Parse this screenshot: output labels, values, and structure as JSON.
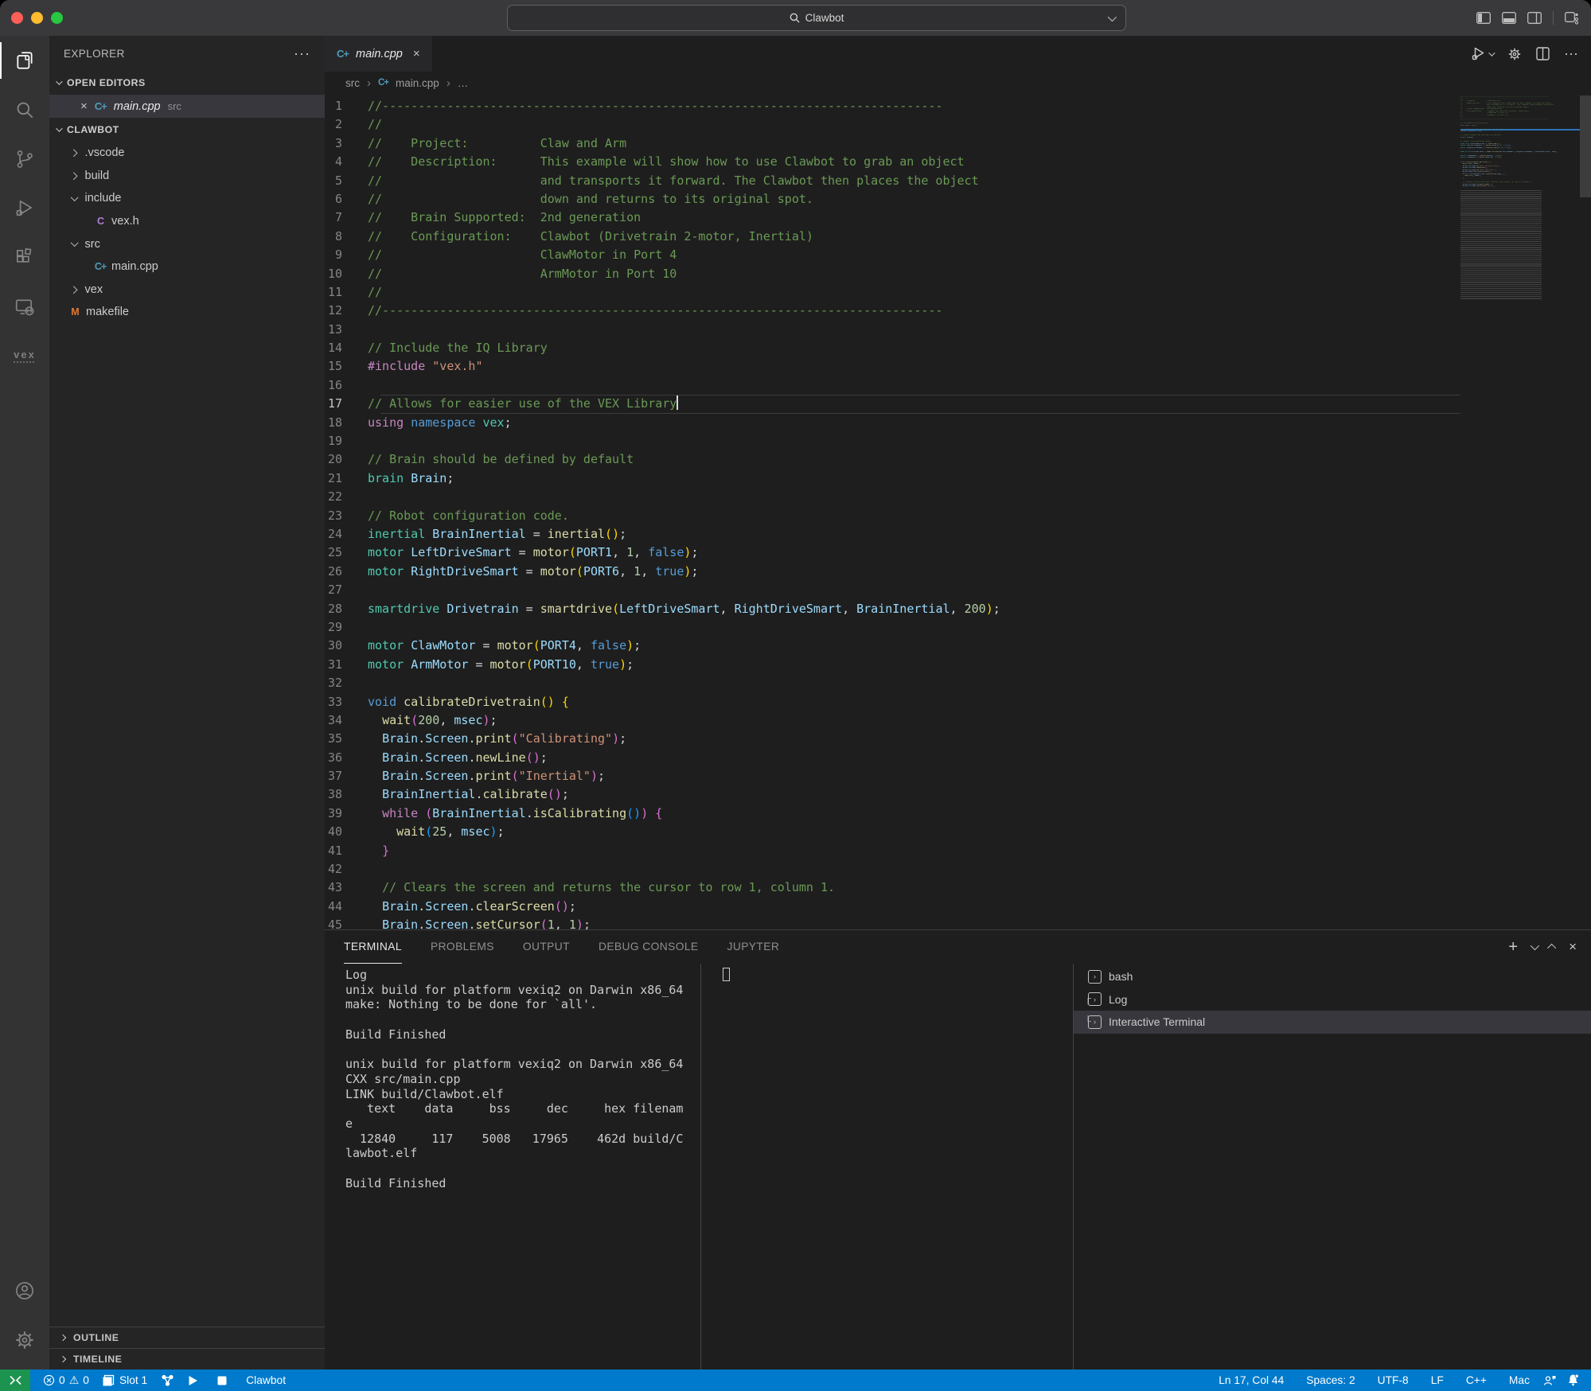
{
  "titlebar": {
    "search_value": "Clawbot"
  },
  "activity_bar": {
    "items": [
      "explorer",
      "search",
      "source-control",
      "run-debug",
      "extensions",
      "remote-explorer",
      "vex"
    ],
    "vex_label": "vex",
    "bottom": [
      "account",
      "settings"
    ]
  },
  "sidebar": {
    "title": "EXPLORER",
    "open_editors_label": "OPEN EDITORS",
    "open_editor": {
      "close": "×",
      "name": "main.cpp",
      "detail": "src"
    },
    "project_label": "CLAWBOT",
    "tree": [
      {
        "label": ".vscode",
        "kind": "folder",
        "state": "collapsed"
      },
      {
        "label": "build",
        "kind": "folder",
        "state": "collapsed"
      },
      {
        "label": "include",
        "kind": "folder",
        "state": "expanded"
      },
      {
        "label": "vex.h",
        "kind": "file",
        "icon": "C",
        "icon_color": "#b180d7",
        "child": true
      },
      {
        "label": "src",
        "kind": "folder",
        "state": "expanded"
      },
      {
        "label": "main.cpp",
        "kind": "file",
        "icon": "C+",
        "icon_color": "#519aba",
        "child": true
      },
      {
        "label": "vex",
        "kind": "folder",
        "state": "collapsed"
      },
      {
        "label": "makefile",
        "kind": "file",
        "icon": "M",
        "icon_color": "#e37933",
        "child": false
      }
    ],
    "bottom_sections": [
      {
        "label": "OUTLINE"
      },
      {
        "label": "TIMELINE"
      }
    ]
  },
  "editor": {
    "tab_title": "main.cpp",
    "breadcrumbs": [
      "src",
      "main.cpp",
      "…"
    ],
    "cursor": {
      "line": 17,
      "col": 44
    },
    "code": [
      [
        [
          "//------------------------------------------------------------------------------",
          "cm"
        ]
      ],
      [
        [
          "//",
          "cm"
        ]
      ],
      [
        [
          "//    Project:          Claw and Arm",
          "cm"
        ]
      ],
      [
        [
          "//    Description:      This example will show how to use Clawbot to grab an object",
          "cm"
        ]
      ],
      [
        [
          "//                      and transports it forward. The Clawbot then places the object",
          "cm"
        ]
      ],
      [
        [
          "//                      down and returns to its original spot.",
          "cm"
        ]
      ],
      [
        [
          "//    Brain Supported:  2nd generation",
          "cm"
        ]
      ],
      [
        [
          "//    Configuration:    Clawbot (Drivetrain 2-motor, Inertial)",
          "cm"
        ]
      ],
      [
        [
          "//                      ClawMotor in Port 4",
          "cm"
        ]
      ],
      [
        [
          "//                      ArmMotor in Port 10",
          "cm"
        ]
      ],
      [
        [
          "//",
          "cm"
        ]
      ],
      [
        [
          "//------------------------------------------------------------------------------",
          "cm"
        ]
      ],
      [],
      [
        [
          "// Include the IQ Library",
          "cm"
        ]
      ],
      [
        [
          "#include",
          "ctl"
        ],
        [
          " ",
          "pl"
        ],
        [
          "\"vex.h\"",
          "str"
        ]
      ],
      [],
      [
        [
          "// Allows for easier use of the VEX Library",
          "cm"
        ]
      ],
      [
        [
          "using",
          "ctl"
        ],
        [
          " ",
          "pl"
        ],
        [
          "namespace",
          "kw"
        ],
        [
          " ",
          "pl"
        ],
        [
          "vex",
          "ty"
        ],
        [
          ";",
          "pl"
        ]
      ],
      [],
      [
        [
          "// Brain should be defined by default",
          "cm"
        ]
      ],
      [
        [
          "brain",
          "ty"
        ],
        [
          " ",
          "pl"
        ],
        [
          "Brain",
          "var"
        ],
        [
          ";",
          "pl"
        ]
      ],
      [],
      [
        [
          "// Robot configuration code.",
          "cm"
        ]
      ],
      [
        [
          "inertial",
          "ty"
        ],
        [
          " ",
          "pl"
        ],
        [
          "BrainInertial",
          "var"
        ],
        [
          " = ",
          "pl"
        ],
        [
          "inertial",
          "fn"
        ],
        [
          "(",
          "p1"
        ],
        [
          ")",
          "p1"
        ],
        [
          ";",
          "pl"
        ]
      ],
      [
        [
          "motor",
          "ty"
        ],
        [
          " ",
          "pl"
        ],
        [
          "LeftDriveSmart",
          "var"
        ],
        [
          " = ",
          "pl"
        ],
        [
          "motor",
          "fn"
        ],
        [
          "(",
          "p1"
        ],
        [
          "PORT1",
          "var"
        ],
        [
          ", ",
          "pl"
        ],
        [
          "1",
          "num"
        ],
        [
          ", ",
          "pl"
        ],
        [
          "false",
          "kw"
        ],
        [
          ")",
          "p1"
        ],
        [
          ";",
          "pl"
        ]
      ],
      [
        [
          "motor",
          "ty"
        ],
        [
          " ",
          "pl"
        ],
        [
          "RightDriveSmart",
          "var"
        ],
        [
          " = ",
          "pl"
        ],
        [
          "motor",
          "fn"
        ],
        [
          "(",
          "p1"
        ],
        [
          "PORT6",
          "var"
        ],
        [
          ", ",
          "pl"
        ],
        [
          "1",
          "num"
        ],
        [
          ", ",
          "pl"
        ],
        [
          "true",
          "kw"
        ],
        [
          ")",
          "p1"
        ],
        [
          ";",
          "pl"
        ]
      ],
      [],
      [
        [
          "smartdrive",
          "ty"
        ],
        [
          " ",
          "pl"
        ],
        [
          "Drivetrain",
          "var"
        ],
        [
          " = ",
          "pl"
        ],
        [
          "smartdrive",
          "fn"
        ],
        [
          "(",
          "p1"
        ],
        [
          "LeftDriveSmart",
          "var"
        ],
        [
          ", ",
          "pl"
        ],
        [
          "RightDriveSmart",
          "var"
        ],
        [
          ", ",
          "pl"
        ],
        [
          "BrainInertial",
          "var"
        ],
        [
          ", ",
          "pl"
        ],
        [
          "200",
          "num"
        ],
        [
          ")",
          "p1"
        ],
        [
          ";",
          "pl"
        ]
      ],
      [],
      [
        [
          "motor",
          "ty"
        ],
        [
          " ",
          "pl"
        ],
        [
          "ClawMotor",
          "var"
        ],
        [
          " = ",
          "pl"
        ],
        [
          "motor",
          "fn"
        ],
        [
          "(",
          "p1"
        ],
        [
          "PORT4",
          "var"
        ],
        [
          ", ",
          "pl"
        ],
        [
          "false",
          "kw"
        ],
        [
          ")",
          "p1"
        ],
        [
          ";",
          "pl"
        ]
      ],
      [
        [
          "motor",
          "ty"
        ],
        [
          " ",
          "pl"
        ],
        [
          "ArmMotor",
          "var"
        ],
        [
          " = ",
          "pl"
        ],
        [
          "motor",
          "fn"
        ],
        [
          "(",
          "p1"
        ],
        [
          "PORT10",
          "var"
        ],
        [
          ", ",
          "pl"
        ],
        [
          "true",
          "kw"
        ],
        [
          ")",
          "p1"
        ],
        [
          ";",
          "pl"
        ]
      ],
      [],
      [
        [
          "void",
          "kw"
        ],
        [
          " ",
          "pl"
        ],
        [
          "calibrateDrivetrain",
          "fn"
        ],
        [
          "(",
          "p1"
        ],
        [
          ")",
          "p1"
        ],
        [
          " ",
          "pl"
        ],
        [
          "{",
          "p1"
        ]
      ],
      [
        [
          "  ",
          "pl"
        ],
        [
          "wait",
          "fn"
        ],
        [
          "(",
          "p2"
        ],
        [
          "200",
          "num"
        ],
        [
          ", ",
          "pl"
        ],
        [
          "msec",
          "var"
        ],
        [
          ")",
          "p2"
        ],
        [
          ";",
          "pl"
        ]
      ],
      [
        [
          "  ",
          "pl"
        ],
        [
          "Brain",
          "var"
        ],
        [
          ".",
          "pl"
        ],
        [
          "Screen",
          "var"
        ],
        [
          ".",
          "pl"
        ],
        [
          "print",
          "fn"
        ],
        [
          "(",
          "p2"
        ],
        [
          "\"Calibrating\"",
          "str"
        ],
        [
          ")",
          "p2"
        ],
        [
          ";",
          "pl"
        ]
      ],
      [
        [
          "  ",
          "pl"
        ],
        [
          "Brain",
          "var"
        ],
        [
          ".",
          "pl"
        ],
        [
          "Screen",
          "var"
        ],
        [
          ".",
          "pl"
        ],
        [
          "newLine",
          "fn"
        ],
        [
          "(",
          "p2"
        ],
        [
          ")",
          "p2"
        ],
        [
          ";",
          "pl"
        ]
      ],
      [
        [
          "  ",
          "pl"
        ],
        [
          "Brain",
          "var"
        ],
        [
          ".",
          "pl"
        ],
        [
          "Screen",
          "var"
        ],
        [
          ".",
          "pl"
        ],
        [
          "print",
          "fn"
        ],
        [
          "(",
          "p2"
        ],
        [
          "\"Inertial\"",
          "str"
        ],
        [
          ")",
          "p2"
        ],
        [
          ";",
          "pl"
        ]
      ],
      [
        [
          "  ",
          "pl"
        ],
        [
          "BrainInertial",
          "var"
        ],
        [
          ".",
          "pl"
        ],
        [
          "calibrate",
          "fn"
        ],
        [
          "(",
          "p2"
        ],
        [
          ")",
          "p2"
        ],
        [
          ";",
          "pl"
        ]
      ],
      [
        [
          "  ",
          "pl"
        ],
        [
          "while",
          "ctl"
        ],
        [
          " ",
          "pl"
        ],
        [
          "(",
          "p2"
        ],
        [
          "BrainInertial",
          "var"
        ],
        [
          ".",
          "pl"
        ],
        [
          "isCalibrating",
          "fn"
        ],
        [
          "(",
          "p3"
        ],
        [
          ")",
          "p3"
        ],
        [
          ")",
          "p2"
        ],
        [
          " ",
          "pl"
        ],
        [
          "{",
          "p2"
        ]
      ],
      [
        [
          "    ",
          "pl"
        ],
        [
          "wait",
          "fn"
        ],
        [
          "(",
          "p3"
        ],
        [
          "25",
          "num"
        ],
        [
          ", ",
          "pl"
        ],
        [
          "msec",
          "var"
        ],
        [
          ")",
          "p3"
        ],
        [
          ";",
          "pl"
        ]
      ],
      [
        [
          "  ",
          "pl"
        ],
        [
          "}",
          "p2"
        ]
      ],
      [],
      [
        [
          "  ",
          "pl"
        ],
        [
          "// Clears the screen and returns the cursor to row 1, column 1.",
          "cm"
        ]
      ],
      [
        [
          "  ",
          "pl"
        ],
        [
          "Brain",
          "var"
        ],
        [
          ".",
          "pl"
        ],
        [
          "Screen",
          "var"
        ],
        [
          ".",
          "pl"
        ],
        [
          "clearScreen",
          "fn"
        ],
        [
          "(",
          "p2"
        ],
        [
          ")",
          "p2"
        ],
        [
          ";",
          "pl"
        ]
      ],
      [
        [
          "  ",
          "pl"
        ],
        [
          "Brain",
          "var"
        ],
        [
          ".",
          "pl"
        ],
        [
          "Screen",
          "var"
        ],
        [
          ".",
          "pl"
        ],
        [
          "setCursor",
          "fn"
        ],
        [
          "(",
          "p2"
        ],
        [
          "1",
          "num"
        ],
        [
          ", ",
          "pl"
        ],
        [
          "1",
          "num"
        ],
        [
          ")",
          "p2"
        ],
        [
          ";",
          "pl"
        ]
      ]
    ]
  },
  "panel": {
    "tabs": [
      {
        "label": "TERMINAL",
        "active": true
      },
      {
        "label": "PROBLEMS",
        "active": false
      },
      {
        "label": "OUTPUT",
        "active": false
      },
      {
        "label": "DEBUG CONSOLE",
        "active": false
      },
      {
        "label": "JUPYTER",
        "active": false
      }
    ],
    "terminal_output": [
      "Log",
      "unix build for platform vexiq2 on Darwin x86_64",
      "make: Nothing to be done for `all'.",
      "",
      "Build Finished",
      "",
      "unix build for platform vexiq2 on Darwin x86_64",
      "CXX src/main.cpp",
      "LINK build/Clawbot.elf",
      "   text    data     bss     dec     hex filenam",
      "e",
      "  12840     117    5008   17965    462d build/C",
      "lawbot.elf",
      "",
      "Build Finished"
    ],
    "terminal_list": [
      {
        "label": "bash",
        "connector": "",
        "selected": false
      },
      {
        "label": "Log",
        "connector": "┌",
        "selected": false
      },
      {
        "label": "Interactive Terminal",
        "connector": "└",
        "selected": true
      }
    ]
  },
  "status_bar": {
    "errors": "0",
    "warnings": "0",
    "slot": "Slot 1",
    "project": "Clawbot",
    "right": [
      "Ln 17, Col 44",
      "Spaces: 2",
      "UTF-8",
      "LF",
      "C++",
      "Mac"
    ]
  }
}
